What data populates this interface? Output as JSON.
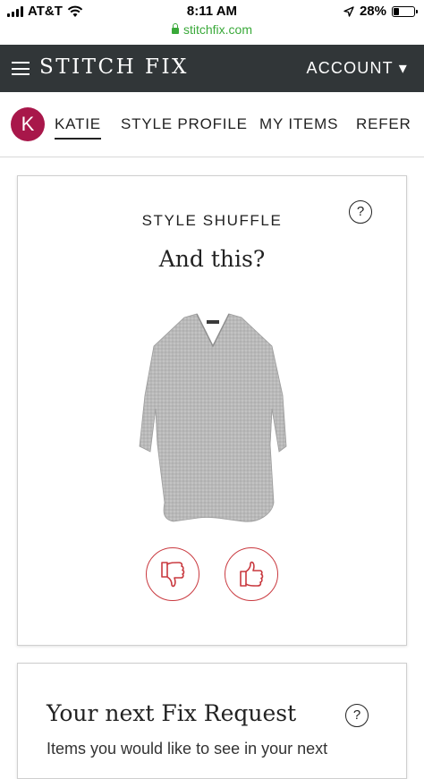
{
  "status_bar": {
    "carrier": "AT&T",
    "time": "8:11 AM",
    "battery": "28%",
    "battery_level": 0.28,
    "url": "stitchfix.com"
  },
  "header": {
    "logo": "STITCH FIX",
    "account_label": "ACCOUNT ▾"
  },
  "nav": {
    "avatar_letter": "K",
    "items": [
      {
        "label": "KATIE",
        "active": true
      },
      {
        "label": "STYLE PROFILE",
        "active": false
      },
      {
        "label": "MY ITEMS",
        "active": false
      },
      {
        "label": "REFER",
        "active": false
      }
    ]
  },
  "style_shuffle": {
    "kicker": "STYLE SHUFFLE",
    "help": "?",
    "prompt": "And this?",
    "item_icon": "gray-dolman-sweater-image",
    "thumbs_down_icon": "thumbs-down-icon",
    "thumbs_up_icon": "thumbs-up-icon"
  },
  "fix_request": {
    "title": "Your next Fix Request",
    "help": "?",
    "description": "Items you would like to see in your next"
  },
  "colors": {
    "header_bg": "#313638",
    "avatar_bg": "#a8174a",
    "vote_red": "#c9393f",
    "url_green": "#3aa93a"
  }
}
